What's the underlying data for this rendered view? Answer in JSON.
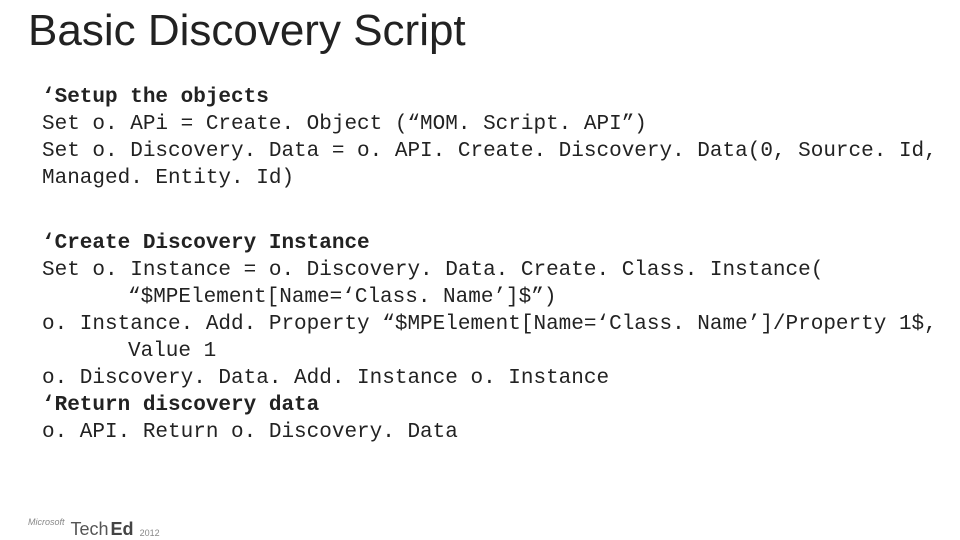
{
  "title": "Basic Discovery Script",
  "section1": {
    "h": "‘Setup the objects",
    "l1": "Set o. APi = Create. Object (“MOM. Script. API”)",
    "l2": "Set o. Discovery. Data = o. API. Create. Discovery. Data(0, Source. Id,",
    "l3": "Managed. Entity. Id)"
  },
  "section2": {
    "h": "‘Create Discovery Instance",
    "l1": "Set o. Instance = o. Discovery. Data. Create. Class. Instance(",
    "l2": "“$MPElement[Name=‘Class. Name’]$”)",
    "l3": "o. Instance. Add. Property “$MPElement[Name=‘Class. Name’]/Property 1$,",
    "l4": "Value 1",
    "l5": "o. Discovery. Data. Add. Instance o. Instance",
    "h2": "‘Return discovery data",
    "l6": "o. API. Return o. Discovery. Data"
  },
  "logo": {
    "ms": "Microsoft",
    "tech": "Tech",
    "ed": "Ed",
    "year": "2012"
  }
}
